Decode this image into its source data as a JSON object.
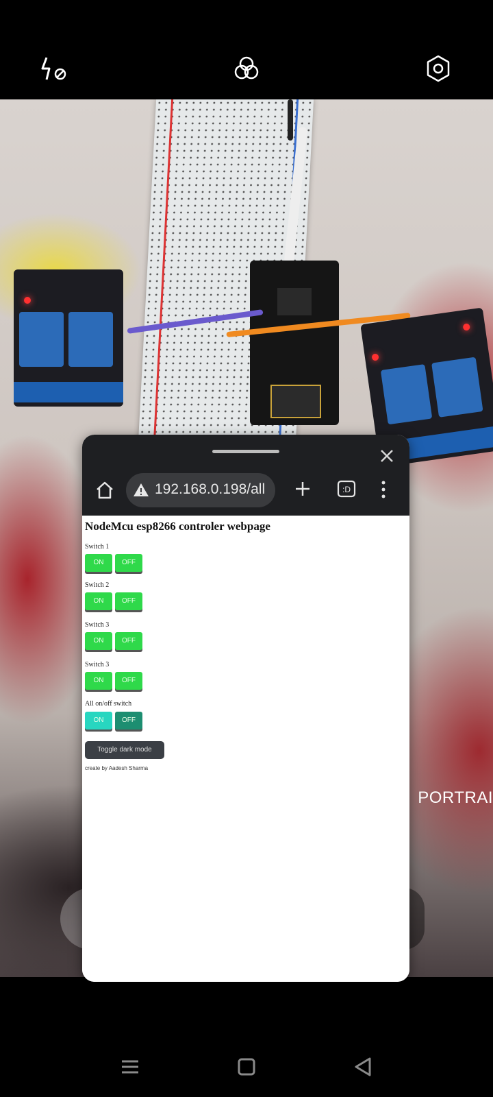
{
  "camera": {
    "top_icons": [
      "flash-off-icon",
      "filters-icon",
      "settings-icon"
    ],
    "mode_label": "PORTRAI"
  },
  "browser": {
    "url": "192.168.0.198/all",
    "page": {
      "title": "NodeMcu esp8266 controler webpage",
      "switches": [
        {
          "label": "Switch 1",
          "on": "ON",
          "off": "OFF"
        },
        {
          "label": "Switch 2",
          "on": "ON",
          "off": "OFF"
        },
        {
          "label": "Switch 3",
          "on": "ON",
          "off": "OFF"
        },
        {
          "label": "Switch 3",
          "on": "ON",
          "off": "OFF"
        }
      ],
      "all_switch": {
        "label": "All on/off switch",
        "on": "ON",
        "off": "OFF"
      },
      "toggle_label": "Toggle dark mode",
      "credit": "create by Aadesh Sharma"
    }
  },
  "nav": [
    "menu-icon",
    "home-icon",
    "back-icon"
  ],
  "colors": {
    "button_green": "#2fd94a",
    "button_teal": "#28d6c0",
    "button_dark_teal": "#1d8e71",
    "chrome_bg": "#1e1f22"
  }
}
